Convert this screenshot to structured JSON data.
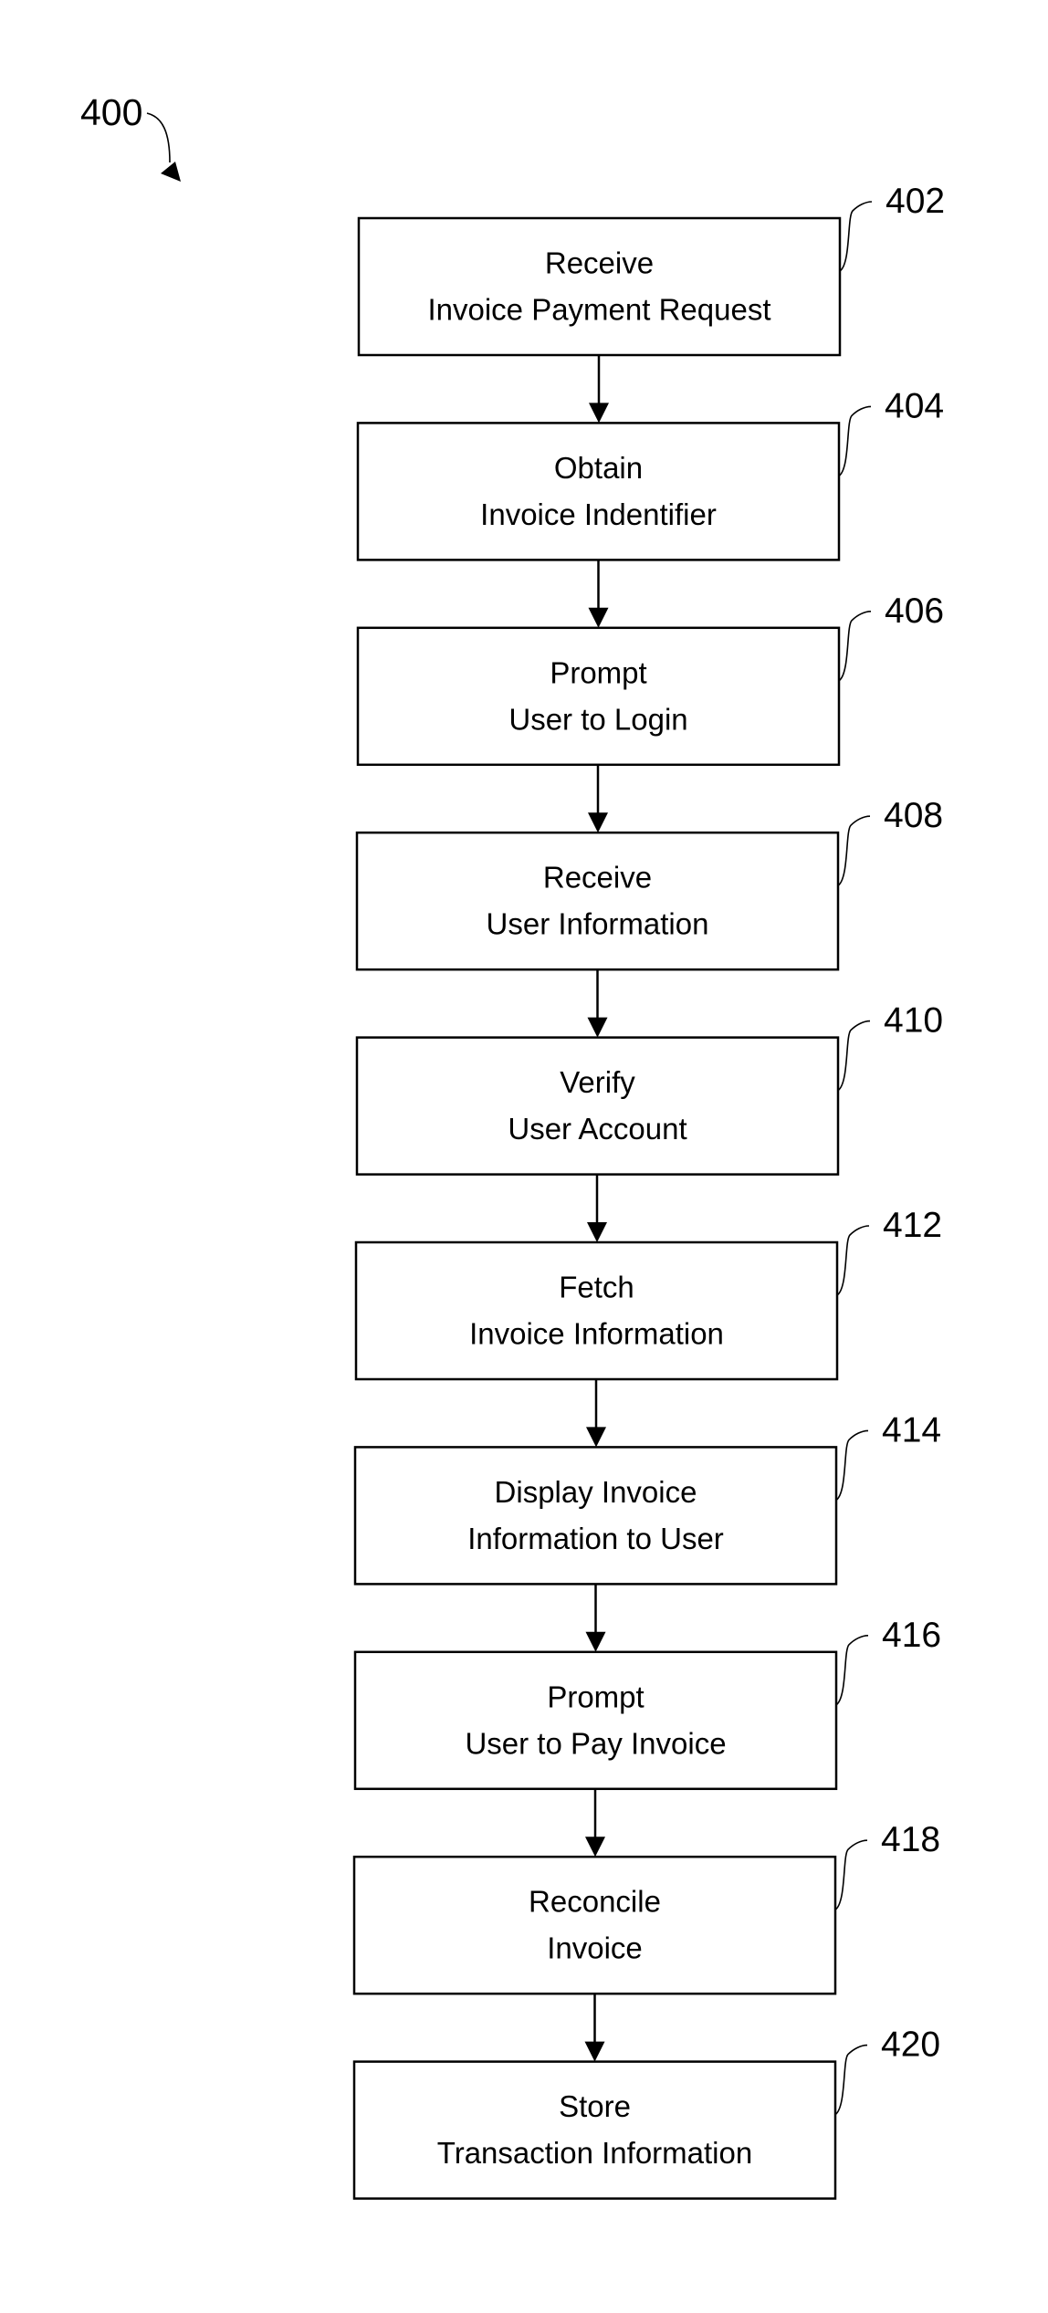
{
  "figure": {
    "label": "400",
    "description": "Flowchart of invoice payment process"
  },
  "steps": [
    {
      "ref": "402",
      "lines": [
        "Receive",
        "Invoice Payment Request"
      ]
    },
    {
      "ref": "404",
      "lines": [
        "Obtain",
        "Invoice Indentifier"
      ]
    },
    {
      "ref": "406",
      "lines": [
        "Prompt",
        "User to Login"
      ]
    },
    {
      "ref": "408",
      "lines": [
        "Receive",
        "User Information"
      ]
    },
    {
      "ref": "410",
      "lines": [
        "Verify",
        "User Account"
      ]
    },
    {
      "ref": "412",
      "lines": [
        "Fetch",
        "Invoice Information"
      ]
    },
    {
      "ref": "414",
      "lines": [
        "Display Invoice",
        "Information to User"
      ]
    },
    {
      "ref": "416",
      "lines": [
        "Prompt",
        "User to Pay Invoice"
      ]
    },
    {
      "ref": "418",
      "lines": [
        "Reconcile",
        "Invoice"
      ]
    },
    {
      "ref": "420",
      "lines": [
        "Store",
        "Transaction Information"
      ]
    }
  ],
  "flow": [
    [
      "402",
      "404"
    ],
    [
      "404",
      "406"
    ],
    [
      "406",
      "408"
    ],
    [
      "408",
      "410"
    ],
    [
      "410",
      "412"
    ],
    [
      "412",
      "414"
    ],
    [
      "414",
      "416"
    ],
    [
      "416",
      "418"
    ],
    [
      "418",
      "420"
    ]
  ],
  "colors": {
    "ink": "#000000",
    "background": "#ffffff"
  }
}
